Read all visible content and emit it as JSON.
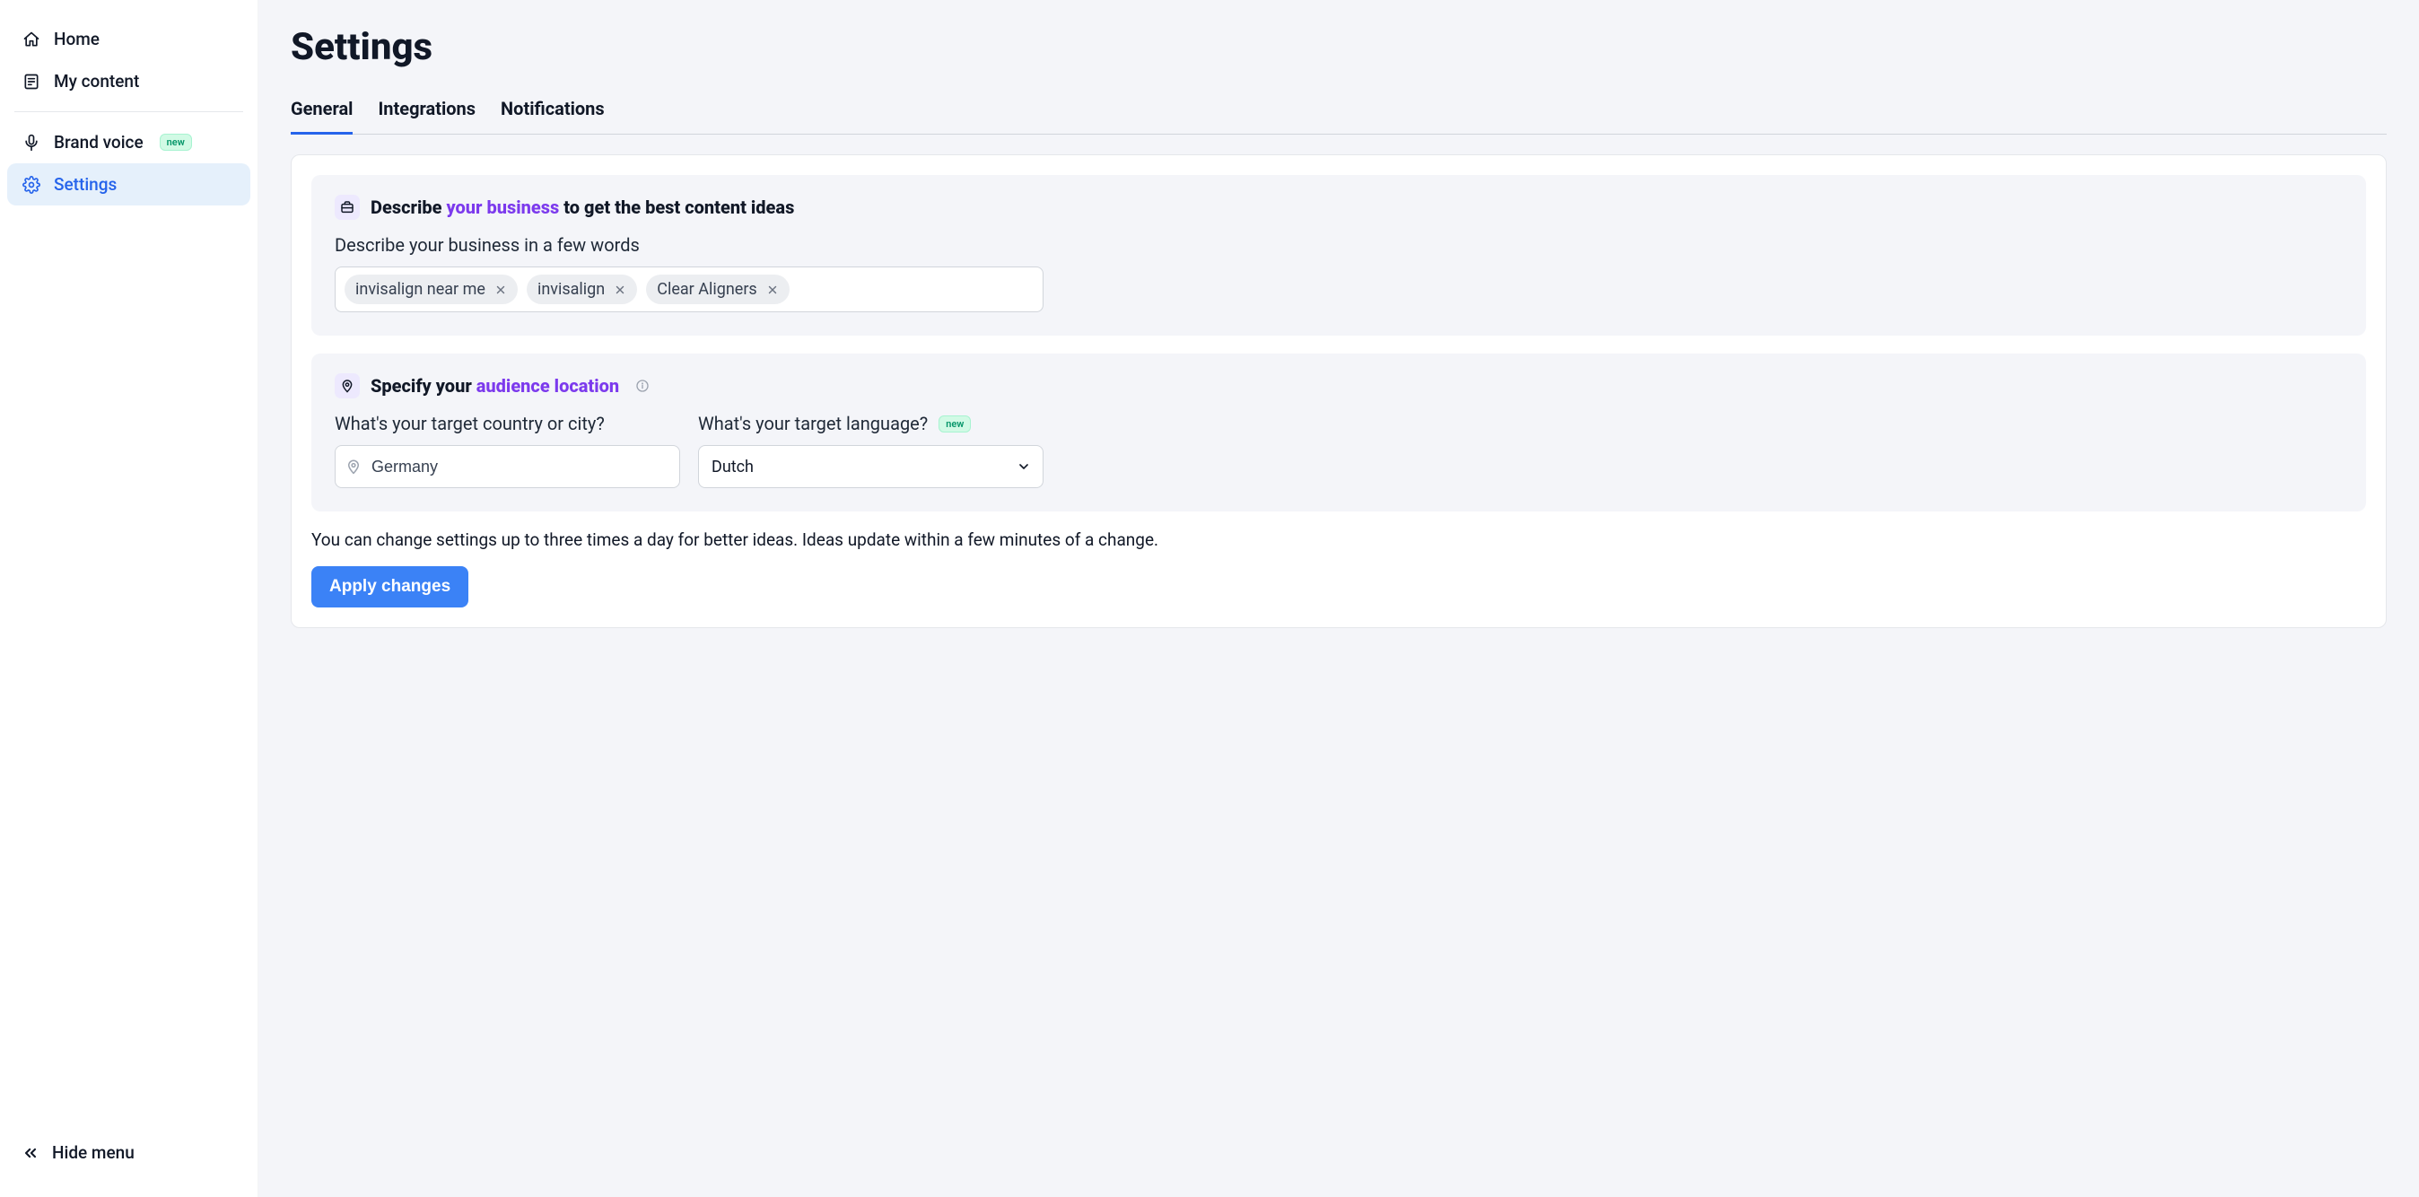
{
  "sidebar": {
    "items": [
      {
        "label": "Home"
      },
      {
        "label": "My content"
      },
      {
        "label": "Brand voice"
      },
      {
        "label": "Settings"
      }
    ],
    "badge_new": "new",
    "hide_menu": "Hide menu"
  },
  "page": {
    "title": "Settings"
  },
  "tabs": {
    "general": "General",
    "integrations": "Integrations",
    "notifications": "Notifications"
  },
  "card_business": {
    "title_prefix": "Describe ",
    "title_highlight": "your business",
    "title_suffix": " to get the best content ideas",
    "field_label": "Describe your business in a few words",
    "tags": [
      "invisalign near me",
      "invisalign",
      "Clear Aligners"
    ]
  },
  "card_audience": {
    "title_prefix": "Specify your ",
    "title_highlight": "audience location",
    "country_label": "What's your target country or city?",
    "country_value": "Germany",
    "language_label": "What's your target language?",
    "language_badge": "new",
    "language_value": "Dutch"
  },
  "help_text": "You can change settings up to three times a day for better ideas. Ideas update within a few minutes of a change.",
  "apply_button": "Apply changes"
}
